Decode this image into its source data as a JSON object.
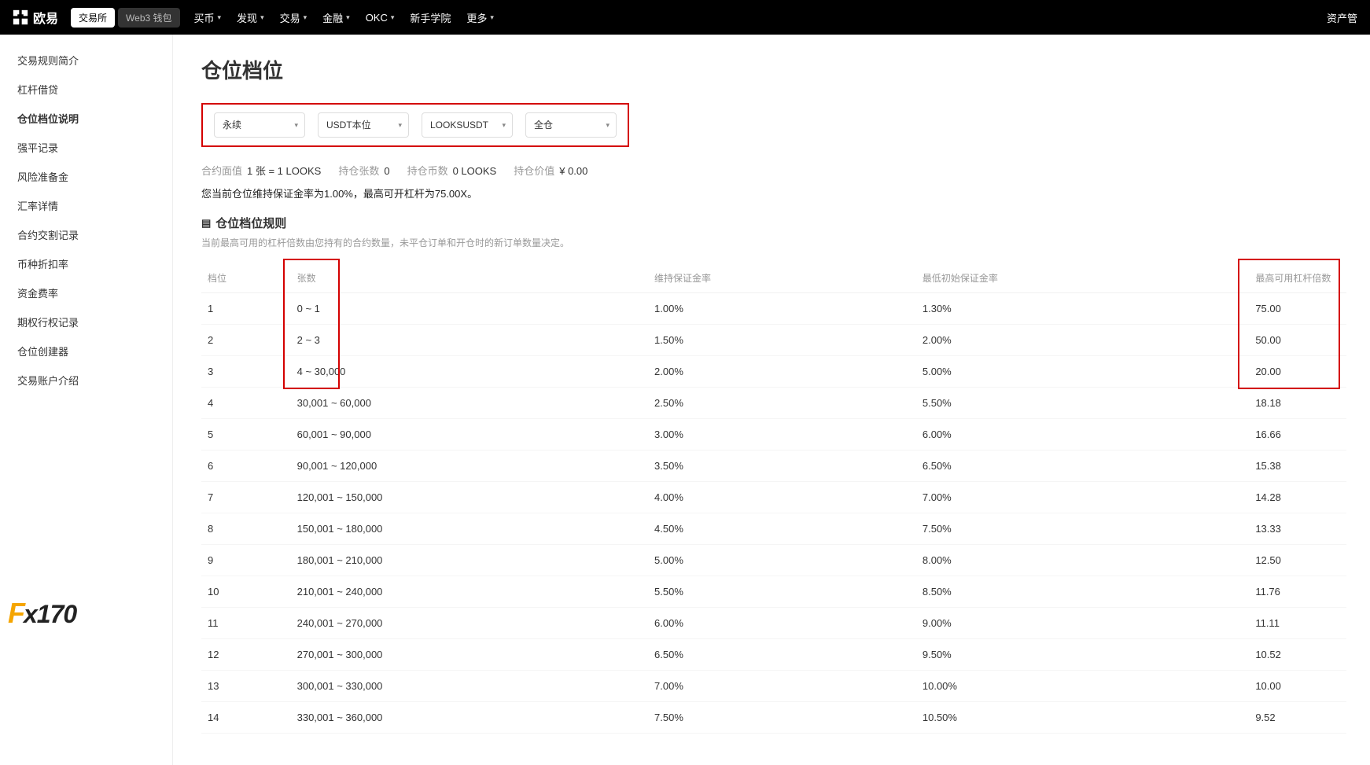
{
  "header": {
    "brand": "欧易",
    "tabs": [
      "交易所",
      "Web3 钱包"
    ],
    "nav": [
      {
        "label": "买币",
        "chev": true
      },
      {
        "label": "发现",
        "chev": true
      },
      {
        "label": "交易",
        "chev": true
      },
      {
        "label": "金融",
        "chev": true
      },
      {
        "label": "OKC",
        "chev": true
      },
      {
        "label": "新手学院",
        "chev": false
      },
      {
        "label": "更多",
        "chev": true
      }
    ],
    "right": "资产管"
  },
  "sidebar": [
    "交易规则简介",
    "杠杆借贷",
    "仓位档位说明",
    "强平记录",
    "风险准备金",
    "汇率详情",
    "合约交割记录",
    "币种折扣率",
    "资金费率",
    "期权行权记录",
    "仓位创建器",
    "交易账户介绍"
  ],
  "sidebar_active_index": 2,
  "page": {
    "title": "仓位档位",
    "filters": [
      "永续",
      "USDT本位",
      "LOOKSUSDT",
      "全仓"
    ],
    "info": [
      {
        "label": "合约面值",
        "value": "1 张 = 1 LOOKS"
      },
      {
        "label": "持仓张数",
        "value": "0"
      },
      {
        "label": "持仓币数",
        "value": "0 LOOKS"
      },
      {
        "label": "持仓价值",
        "value": "¥ 0.00"
      }
    ],
    "desc": "您当前仓位维持保证金率为1.00%，最高可开杠杆为75.00X。",
    "rule_head": "仓位档位规则",
    "rule_sub": "当前最高可用的杠杆倍数由您持有的合约数量，未平仓订单和开仓时的新订单数量决定。",
    "table": {
      "columns": [
        "档位",
        "张数",
        "维持保证金率",
        "最低初始保证金率",
        "最高可用杠杆倍数"
      ],
      "rows": [
        {
          "tier": "1",
          "range": "0 ~ 1",
          "m1": "1.00%",
          "m2": "1.30%",
          "lev": "75.00"
        },
        {
          "tier": "2",
          "range": "2 ~ 3",
          "m1": "1.50%",
          "m2": "2.00%",
          "lev": "50.00"
        },
        {
          "tier": "3",
          "range": "4 ~ 30,000",
          "m1": "2.00%",
          "m2": "5.00%",
          "lev": "20.00"
        },
        {
          "tier": "4",
          "range": "30,001 ~ 60,000",
          "m1": "2.50%",
          "m2": "5.50%",
          "lev": "18.18"
        },
        {
          "tier": "5",
          "range": "60,001 ~ 90,000",
          "m1": "3.00%",
          "m2": "6.00%",
          "lev": "16.66"
        },
        {
          "tier": "6",
          "range": "90,001 ~ 120,000",
          "m1": "3.50%",
          "m2": "6.50%",
          "lev": "15.38"
        },
        {
          "tier": "7",
          "range": "120,001 ~ 150,000",
          "m1": "4.00%",
          "m2": "7.00%",
          "lev": "14.28"
        },
        {
          "tier": "8",
          "range": "150,001 ~ 180,000",
          "m1": "4.50%",
          "m2": "7.50%",
          "lev": "13.33"
        },
        {
          "tier": "9",
          "range": "180,001 ~ 210,000",
          "m1": "5.00%",
          "m2": "8.00%",
          "lev": "12.50"
        },
        {
          "tier": "10",
          "range": "210,001 ~ 240,000",
          "m1": "5.50%",
          "m2": "8.50%",
          "lev": "11.76"
        },
        {
          "tier": "11",
          "range": "240,001 ~ 270,000",
          "m1": "6.00%",
          "m2": "9.00%",
          "lev": "11.11"
        },
        {
          "tier": "12",
          "range": "270,001 ~ 300,000",
          "m1": "6.50%",
          "m2": "9.50%",
          "lev": "10.52"
        },
        {
          "tier": "13",
          "range": "300,001 ~ 330,000",
          "m1": "7.00%",
          "m2": "10.00%",
          "lev": "10.00"
        },
        {
          "tier": "14",
          "range": "330,001 ~ 360,000",
          "m1": "7.50%",
          "m2": "10.50%",
          "lev": "9.52"
        }
      ]
    }
  },
  "watermark": {
    "f": "F",
    "rest": "x170"
  }
}
